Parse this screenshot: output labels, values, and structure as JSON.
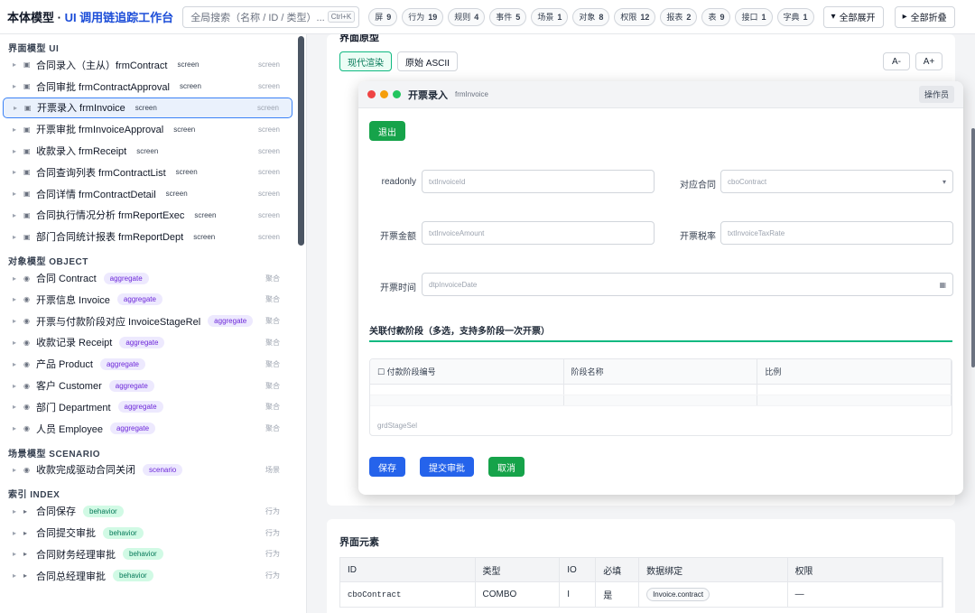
{
  "header": {
    "title_main": "本体模型 · ",
    "title_accent": "UI 调用链追踪工作台",
    "search_placeholder": "全局搜索（名称 / ID / 类型）...",
    "search_shortcut": "Ctrl+K",
    "counts": [
      {
        "label": "屏",
        "value": "9"
      },
      {
        "label": "行为",
        "value": "19"
      },
      {
        "label": "规则",
        "value": "4"
      },
      {
        "label": "事件",
        "value": "5"
      },
      {
        "label": "场景",
        "value": "1"
      },
      {
        "label": "对象",
        "value": "8"
      },
      {
        "label": "权限",
        "value": "12"
      },
      {
        "label": "报表",
        "value": "2"
      },
      {
        "label": "表",
        "value": "9"
      },
      {
        "label": "接口",
        "value": "1"
      },
      {
        "label": "字典",
        "value": "1"
      }
    ],
    "expand_all": "全部展开",
    "collapse_all": "全部折叠"
  },
  "sidebar": {
    "sections": [
      {
        "title": "界面模型 UI",
        "items": [
          {
            "label": "合同录入（主从）frmContract",
            "badge": "screen",
            "kind": "screen",
            "badge_style": "screen"
          },
          {
            "label": "合同审批 frmContractApproval",
            "badge": "screen",
            "kind": "screen",
            "badge_style": "screen"
          },
          {
            "label": "开票录入 frmInvoice",
            "badge": "screen",
            "kind": "screen",
            "badge_style": "screen",
            "active": true
          },
          {
            "label": "开票审批 frmInvoiceApproval",
            "badge": "screen",
            "kind": "screen",
            "badge_style": "screen"
          },
          {
            "label": "收款录入 frmReceipt",
            "badge": "screen",
            "kind": "screen",
            "badge_style": "screen"
          },
          {
            "label": "合同查询列表 frmContractList",
            "badge": "screen",
            "kind": "screen",
            "badge_style": "screen"
          },
          {
            "label": "合同详情 frmContractDetail",
            "badge": "screen",
            "kind": "screen",
            "badge_style": "screen"
          },
          {
            "label": "合同执行情况分析 frmReportExec",
            "badge": "screen",
            "kind": "screen",
            "badge_style": "screen"
          },
          {
            "label": "部门合同统计报表 frmReportDept",
            "badge": "screen",
            "kind": "screen",
            "badge_style": "screen"
          }
        ]
      },
      {
        "title": "对象模型 OBJECT",
        "items": [
          {
            "label": "合同 Contract",
            "badge": "aggregate",
            "kind": "聚合",
            "badge_style": "agg"
          },
          {
            "label": "开票信息 Invoice",
            "badge": "aggregate",
            "kind": "聚合",
            "badge_style": "agg"
          },
          {
            "label": "开票与付款阶段对应 InvoiceStageRel",
            "badge": "aggregate",
            "kind": "聚合",
            "badge_style": "agg"
          },
          {
            "label": "收款记录 Receipt",
            "badge": "aggregate",
            "kind": "聚合",
            "badge_style": "agg"
          },
          {
            "label": "产品 Product",
            "badge": "aggregate",
            "kind": "聚合",
            "badge_style": "agg"
          },
          {
            "label": "客户 Customer",
            "badge": "aggregate",
            "kind": "聚合",
            "badge_style": "agg"
          },
          {
            "label": "部门 Department",
            "badge": "aggregate",
            "kind": "聚合",
            "badge_style": "agg"
          },
          {
            "label": "人员 Employee",
            "badge": "aggregate",
            "kind": "聚合",
            "badge_style": "agg"
          }
        ]
      },
      {
        "title": "场景模型 SCENARIO",
        "items": [
          {
            "label": "收款完成驱动合同关闭",
            "badge": "scenario",
            "kind": "场景",
            "badge_style": "scn"
          }
        ]
      },
      {
        "title": "索引 INDEX",
        "items": [
          {
            "label": "合同保存",
            "badge": "behavior",
            "kind": "行为",
            "badge_style": "beh"
          },
          {
            "label": "合同提交审批",
            "badge": "behavior",
            "kind": "行为",
            "badge_style": "beh"
          },
          {
            "label": "合同财务经理审批",
            "badge": "behavior",
            "kind": "行为",
            "badge_style": "beh"
          },
          {
            "label": "合同总经理审批",
            "badge": "behavior",
            "kind": "行为",
            "badge_style": "beh"
          }
        ]
      }
    ]
  },
  "preview": {
    "section_title": "界面原型",
    "mode_modern": "现代渲染",
    "mode_ascii": "原始 ASCII",
    "zoom_out": "A-",
    "zoom_in": "A+",
    "window_title": "开票录入",
    "window_sub": "frmInvoice",
    "role": "操作员",
    "exit": "退出",
    "fields": {
      "readonly_label": "readonly",
      "invoice_id": "txtInvoiceId",
      "contract_label": "对应合同",
      "contract": "cboContract",
      "amount_label": "开票金额",
      "amount": "txtInvoiceAmount",
      "taxrate_label": "开票税率",
      "taxrate": "txtInvoiceTaxRate",
      "date_label": "开票时间",
      "date": "dtpInvoiceDate"
    },
    "stage_title": "关联付款阶段（多选，支持多阶段一次开票）",
    "grid_cols": [
      "☐ 付款阶段编号",
      "阶段名称",
      "比例"
    ],
    "grid_name": "grdStageSel",
    "save": "保存",
    "submit": "提交审批",
    "cancel": "取消"
  },
  "elements": {
    "title": "界面元素",
    "columns": [
      "ID",
      "类型",
      "IO",
      "必填",
      "数据绑定",
      "权限"
    ],
    "rows": [
      {
        "id": "cboContract",
        "type": "COMBO",
        "io": "I",
        "required": "是",
        "binding": "Invoice.contract",
        "perm": "—"
      }
    ]
  },
  "colors": {
    "accent": "#1d4ed8",
    "green": "#16a34a",
    "blue": "#2563eb"
  }
}
